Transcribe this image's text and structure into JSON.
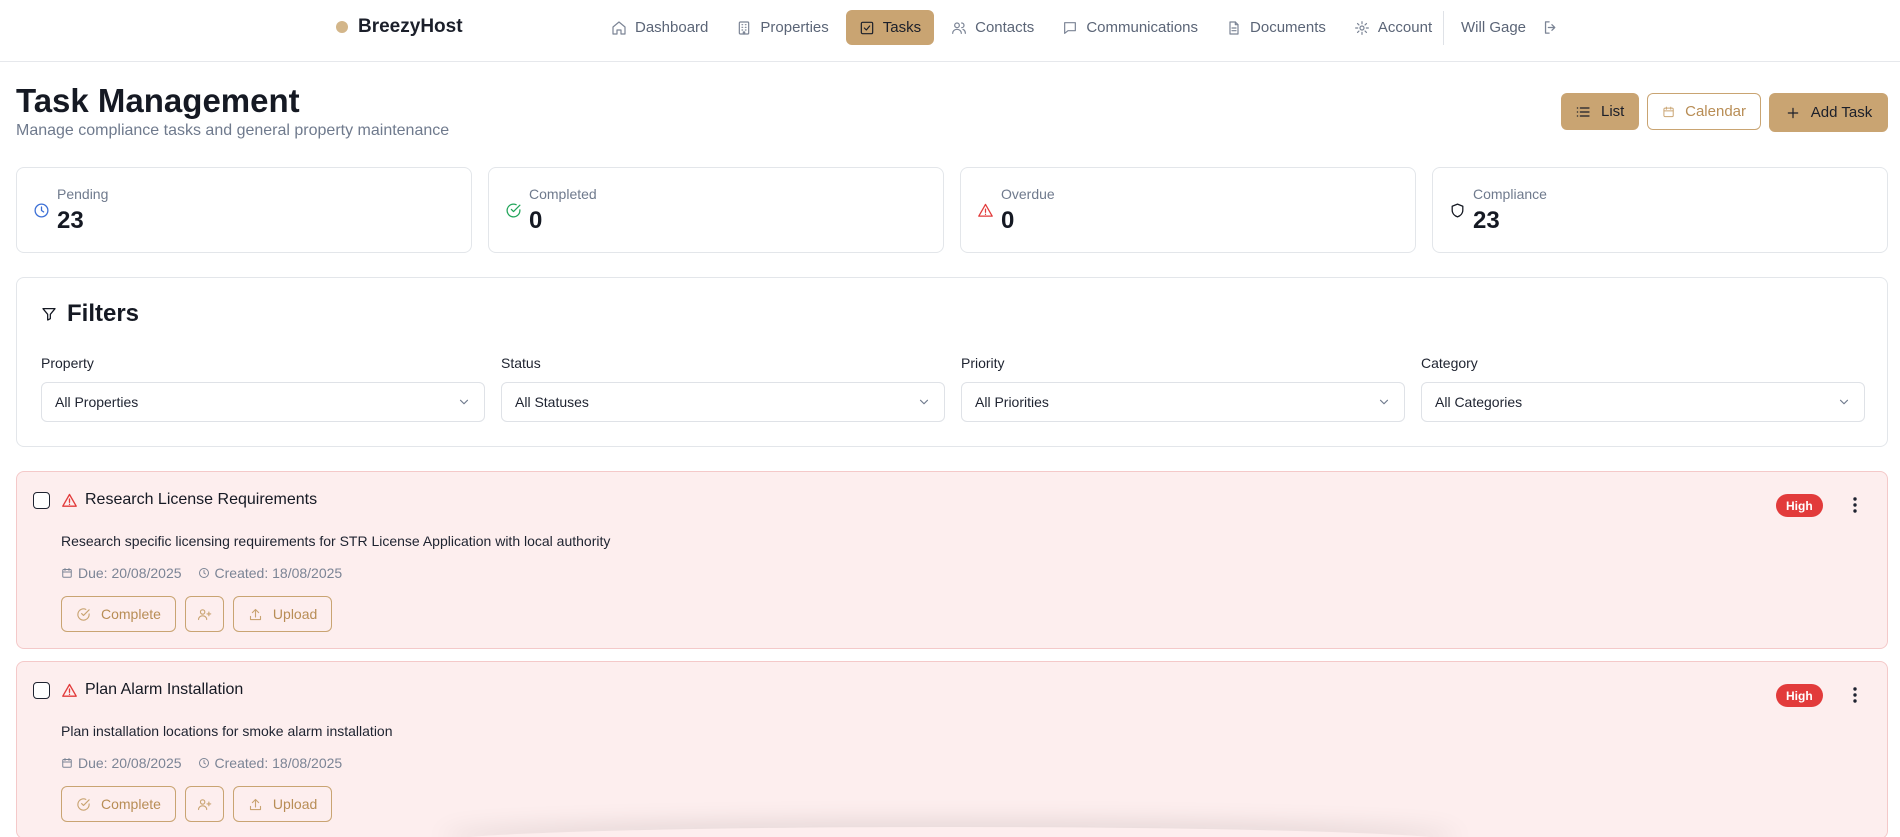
{
  "app": {
    "brand": "BreezyHost",
    "brand_dot_color": "#d3b68a"
  },
  "nav": {
    "items": [
      {
        "label": "Dashboard",
        "icon": "home-icon",
        "active": false
      },
      {
        "label": "Properties",
        "icon": "building-icon",
        "active": false
      },
      {
        "label": "Tasks",
        "icon": "checkbox-icon",
        "active": true
      },
      {
        "label": "Contacts",
        "icon": "users-icon",
        "active": false
      },
      {
        "label": "Communications",
        "icon": "message-icon",
        "active": false
      },
      {
        "label": "Documents",
        "icon": "document-icon",
        "active": false
      },
      {
        "label": "Account",
        "icon": "gear-icon",
        "active": false
      }
    ],
    "user_name": "Will Gage",
    "logout_icon": "logout-icon"
  },
  "page": {
    "title": "Task Management",
    "subtitle": "Manage compliance tasks and general property maintenance"
  },
  "view_toggle": {
    "list_label": "List",
    "calendar_label": "Calendar",
    "active": "List"
  },
  "add_task_label": "Add Task",
  "stats": [
    {
      "label": "Pending",
      "value": "23",
      "icon": "clock-icon",
      "color": "#3b6fd6"
    },
    {
      "label": "Completed",
      "value": "0",
      "icon": "check-circle-icon",
      "color": "#22a55a"
    },
    {
      "label": "Overdue",
      "value": "0",
      "icon": "alert-triangle-icon",
      "color": "#e23b3b"
    },
    {
      "label": "Compliance",
      "value": "23",
      "icon": "shield-icon",
      "color": "#151923"
    }
  ],
  "filters": {
    "title": "Filters",
    "fields": [
      {
        "label": "Property",
        "value": "All Properties"
      },
      {
        "label": "Status",
        "value": "All Statuses"
      },
      {
        "label": "Priority",
        "value": "All Priorities"
      },
      {
        "label": "Category",
        "value": "All Categories"
      }
    ]
  },
  "tasks": [
    {
      "title": "Research License Requirements",
      "description": "Research specific licensing requirements for STR License Application with local authority",
      "due": "Due: 20/08/2025",
      "created": "Created: 18/08/2025",
      "priority": "High",
      "actions": {
        "complete": "Complete",
        "upload": "Upload"
      }
    },
    {
      "title": "Plan Alarm Installation",
      "description": "Plan installation locations for smoke alarm installation",
      "due": "Due: 20/08/2025",
      "created": "Created: 18/08/2025",
      "priority": "High",
      "actions": {
        "complete": "Complete",
        "upload": "Upload"
      }
    }
  ],
  "colors": {
    "accent": "#c9a472",
    "danger": "#e23b3b",
    "task_bg": "#fdeeee"
  }
}
